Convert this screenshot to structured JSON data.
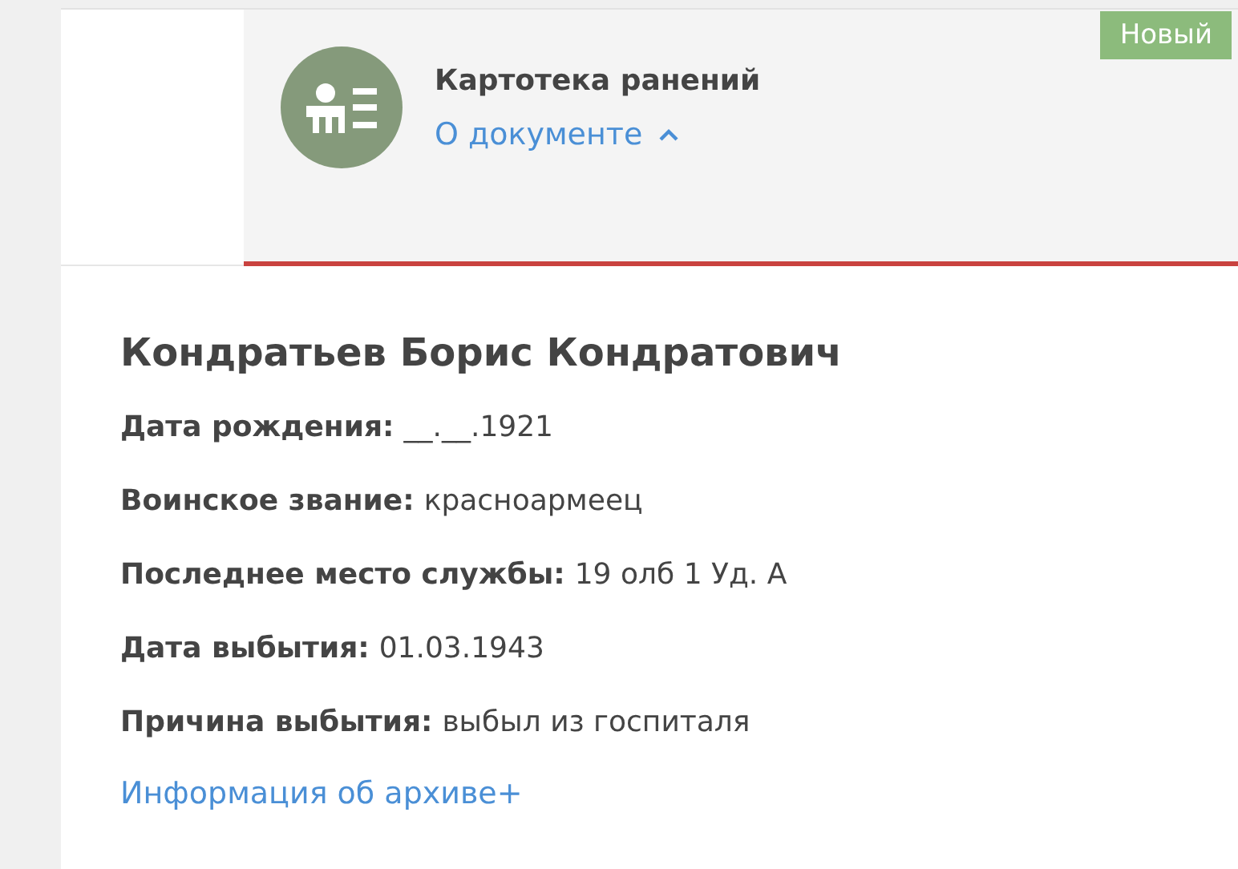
{
  "document": {
    "title": "Картотека ранений",
    "details_link": {
      "label": "О документе",
      "expanded": true
    },
    "badge": "Новый"
  },
  "person": {
    "name": "Кондратьев Борис Кондратович",
    "fields": [
      {
        "label": "Дата рождения:",
        "value": "__.__.1921"
      },
      {
        "label": "Воинское звание:",
        "value": "красноармеец"
      },
      {
        "label": "Последнее место службы:",
        "value": "19 олб 1 Уд. А"
      },
      {
        "label": "Дата выбытия:",
        "value": "01.03.1943"
      },
      {
        "label": "Причина выбытия:",
        "value": "выбыл из госпиталя"
      }
    ],
    "archive_link": "Информация об архиве+"
  }
}
